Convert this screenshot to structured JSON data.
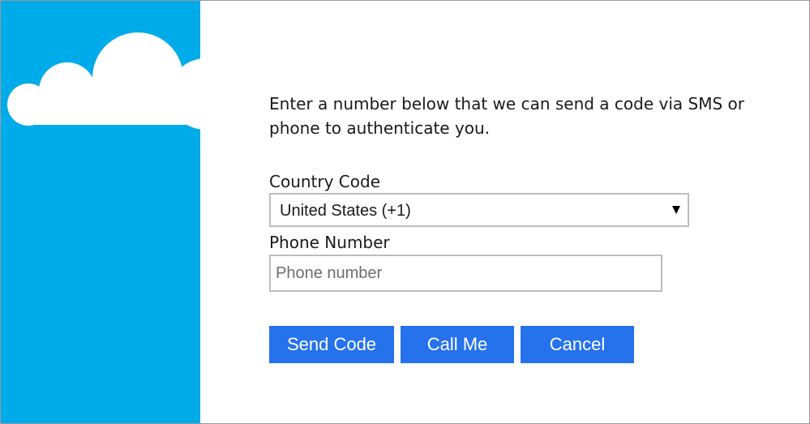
{
  "colors": {
    "side_panel": "#00abe9",
    "cloud": "#ffffff",
    "button": "#2672ec",
    "button_text": "#ffffff"
  },
  "side_panel": {
    "illustration": "cloud-icon"
  },
  "form": {
    "intro": "Enter a number below that we can send a code via SMS or phone to authenticate you.",
    "country_code_label": "Country Code",
    "country_code_value": "United States (+1)",
    "phone_number_label": "Phone Number",
    "phone_number_placeholder": "Phone number",
    "phone_number_value": ""
  },
  "buttons": {
    "send_code": "Send Code",
    "call_me": "Call Me",
    "cancel": "Cancel"
  }
}
